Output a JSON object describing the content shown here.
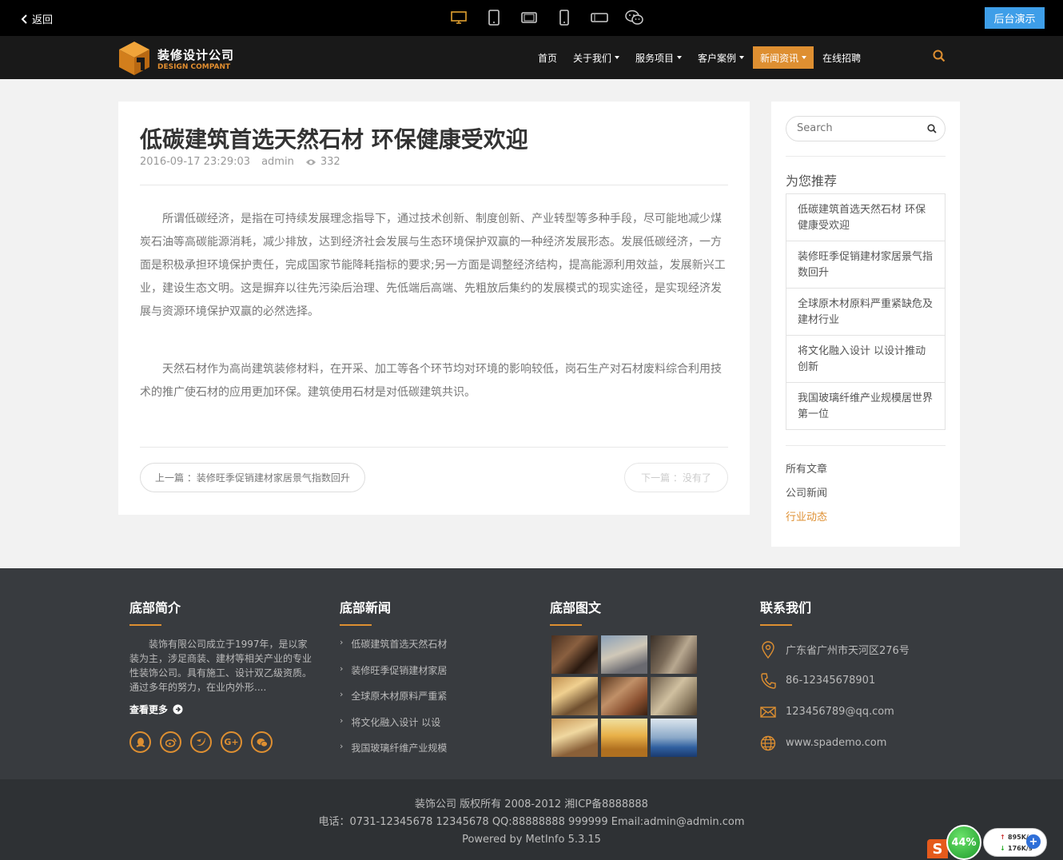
{
  "topbar": {
    "back_label": "返回",
    "devices": [
      "desktop-icon",
      "tablet-icon",
      "tablet-landscape-icon",
      "phone-icon",
      "phone-landscape-icon",
      "wechat-icon"
    ],
    "admin_label": "后台演示"
  },
  "header": {
    "logo_cn": "装修设计公司",
    "logo_en": "DESIGN COMPANT",
    "nav": [
      {
        "label": "首页",
        "dropdown": false
      },
      {
        "label": "关于我们",
        "dropdown": true
      },
      {
        "label": "服务项目",
        "dropdown": true
      },
      {
        "label": "客户案例",
        "dropdown": true
      },
      {
        "label": "新闻资讯",
        "dropdown": true,
        "active": true
      },
      {
        "label": "在线招聘",
        "dropdown": false
      }
    ]
  },
  "article": {
    "title": "低碳建筑首选天然石材 环保健康受欢迎",
    "date": "2016-09-17 23:29:03",
    "author": "admin",
    "views": "332",
    "paragraphs": [
      "所谓低碳经济，是指在可持续发展理念指导下，通过技术创新、制度创新、产业转型等多种手段，尽可能地减少煤炭石油等高碳能源消耗，减少排放，达到经济社会发展与生态环境保护双赢的一种经济发展形态。发展低碳经济，一方面是积极承担环境保护责任，完成国家节能降耗指标的要求;另一方面是调整经济结构，提高能源利用效益，发展新兴工业，建设生态文明。这是摒弃以往先污染后治理、先低端后高端、先粗放后集约的发展模式的现实途径，是实现经济发展与资源环境保护双赢的必然选择。",
      "天然石材作为高尚建筑装修材料，在开采、加工等各个环节均对环境的影响较低，岗石生产对石材废料综合利用技术的推广使石材的应用更加环保。建筑使用石材是对低碳建筑共识。"
    ],
    "prev_label": "上一篇 ：装修旺季促销建材家居景气指数回升",
    "next_label": "下一篇 ：没有了"
  },
  "sidebar": {
    "search_placeholder": "Search",
    "recommend_title": "为您推荐",
    "recommend": [
      "低碳建筑首选天然石材 环保健康受欢迎",
      "装修旺季促销建材家居景气指数回升",
      "全球原木材原料严重紧缺危及建材行业",
      "将文化融入设计 以设计推动创新",
      "我国玻璃纤维产业规模居世界第一位"
    ],
    "categories": [
      "所有文章",
      "公司新闻",
      "行业动态"
    ]
  },
  "footer": {
    "about_title": "底部简介",
    "about_text": "装饰有限公司成立于1997年，是以家装为主，涉足商装、建材等相关产业的专业性装饰公司。具有施工、设计双乙级资质。通过多年的努力，在业内外形....",
    "more_label": "查看更多",
    "socials": [
      "qq-icon",
      "weibo-icon",
      "twitter-icon",
      "google-plus-icon",
      "wechat-icon"
    ],
    "news_title": "底部新闻",
    "news": [
      "低碳建筑首选天然石材",
      "装修旺季促销建材家居",
      "全球原木材原料严重紧",
      "将文化融入设计 以设",
      "我国玻璃纤维产业规模"
    ],
    "gallery_title": "底部图文",
    "gallery_count": 9,
    "contact_title": "联系我们",
    "contacts": [
      {
        "icon": "location-icon",
        "text": "广东省广州市天河区276号"
      },
      {
        "icon": "phone-icon",
        "text": "86-12345678901"
      },
      {
        "icon": "mail-icon",
        "text": "123456789@qq.com"
      },
      {
        "icon": "globe-icon",
        "text": "www.spademo.com"
      }
    ]
  },
  "copyright": {
    "line1": "装饰公司 版权所有 2008-2012 湘ICP备8888888",
    "line2": "电话：0731-12345678 12345678 QQ:88888888 999999 Email:admin@admin.com",
    "line3": "Powered by MetInfo 5.3.15"
  },
  "widget": {
    "percent": "44%",
    "up_speed": "895K/s",
    "down_speed": "176K/s"
  },
  "colors": {
    "accent": "#de8f31",
    "admin_button": "#3e9ee8",
    "footer_bg": "#383b3f"
  }
}
